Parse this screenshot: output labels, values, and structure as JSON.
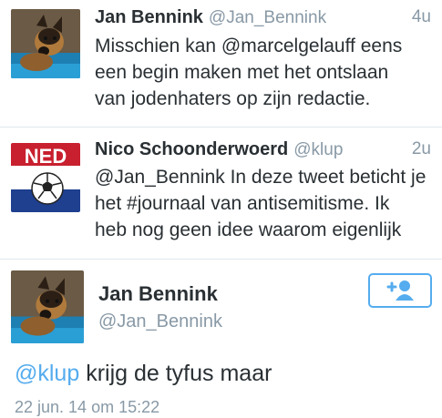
{
  "tweets": [
    {
      "name": "Jan Bennink",
      "handle": "@Jan_Bennink",
      "time": "4u",
      "lines": [
        "Misschien kan @marcelgelauff eens",
        "een begin maken met het ontslaan",
        "van jodenhaters op zijn redactie."
      ]
    },
    {
      "name": "Nico Schoonderwoerd",
      "handle": "@klup",
      "time": "2u",
      "avatar_text": "NED",
      "lines": [
        "@Jan_Bennink In deze tweet beticht je",
        "het #journaal van antisemitisme. Ik",
        "heb nog geen idee waarom eigenlijk"
      ]
    }
  ],
  "detail": {
    "name": "Jan Bennink",
    "handle": "@Jan_Bennink",
    "reply_mention": "@klup",
    "reply_text": " krijg de tyfus maar",
    "date": "22 jun. 14 om 15:22",
    "follow_icon": "add-user-icon"
  },
  "colors": {
    "link": "#55acee",
    "muted": "#8899a6",
    "text": "#292f33"
  }
}
